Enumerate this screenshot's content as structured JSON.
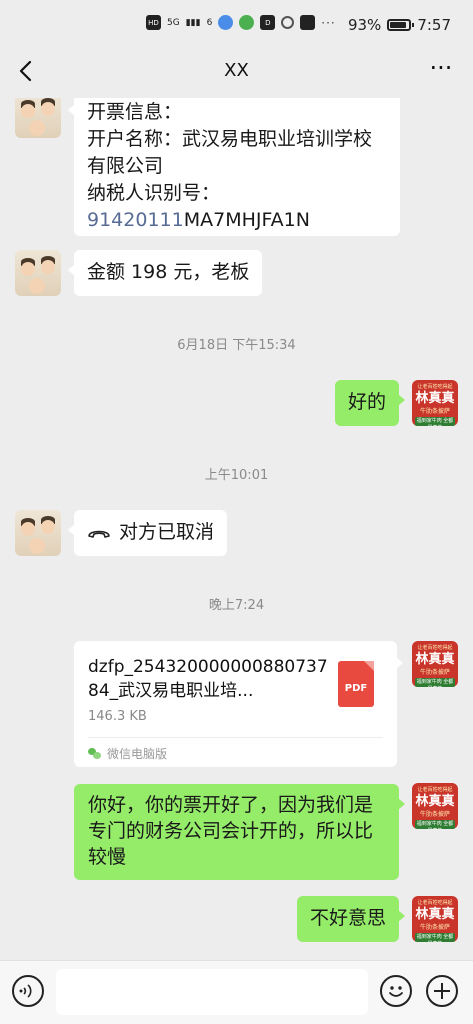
{
  "status_bar": {
    "network_labels": [
      "HD",
      "5G",
      "6"
    ],
    "battery": "93%",
    "time": "7:57"
  },
  "header": {
    "title": "XX",
    "back_icon": "chevron-left-icon",
    "more_icon": "more-dots-icon"
  },
  "messages": {
    "m1": {
      "lines": [
        "开票信息：",
        "开户名称：武汉易电职业培训学校",
        "有限公司",
        "纳税人识别号："
      ],
      "tax_id_link": "91420111",
      "tax_id_rest": "MA7MHJFA1N"
    },
    "m2": {
      "text": "金额 198 元，老板"
    },
    "time1": "6月18日 下午15:34",
    "m3": {
      "text": "好的"
    },
    "time2": "上午10:01",
    "m4": {
      "text": "对方已取消",
      "icon": "phone-hangup-icon"
    },
    "time3": "晚上7:24",
    "file": {
      "name": "dzfp_25432000000088073784_武汉易电职业培...",
      "size": "146.3 KB",
      "icon_label": "PDF",
      "source": "微信电脑版"
    },
    "m5": {
      "text": "你好，你的票开好了，因为我们是专门的财务公司会计开的，所以比较慢"
    },
    "m6": {
      "text": "不好意思"
    }
  },
  "brand_avatar": {
    "line1": "让老百姓吃得起",
    "name": "林真真",
    "sub": "牛肋条披萨",
    "tag": "福到家牛肉 全都是真牛"
  },
  "input_bar": {
    "placeholder": ""
  },
  "colors": {
    "background": "#ededed",
    "bubble_green": "#95ec69",
    "bubble_white": "#ffffff",
    "link_blue": "#576b95",
    "brand_red": "#c9352b"
  }
}
